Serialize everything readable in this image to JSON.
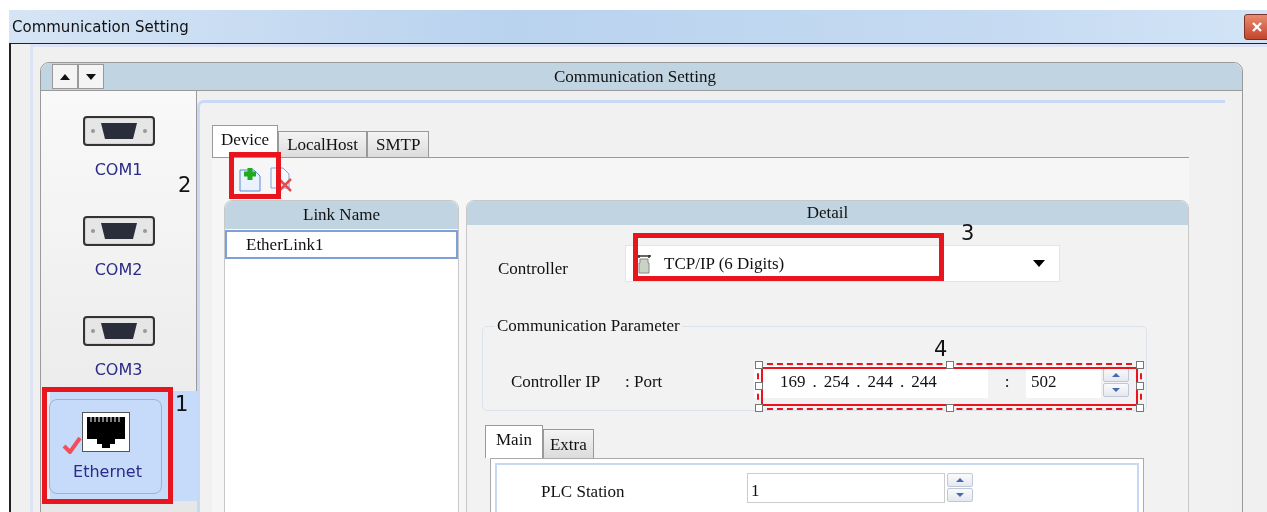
{
  "window": {
    "title": "Communication Setting"
  },
  "panel": {
    "title": "Communication Setting"
  },
  "sidebar": {
    "items": [
      {
        "label": "COM1",
        "kind": "serial",
        "selected": false
      },
      {
        "label": "COM2",
        "kind": "serial",
        "selected": false
      },
      {
        "label": "COM3",
        "kind": "serial",
        "selected": false
      },
      {
        "label": "Ethernet",
        "kind": "ethernet",
        "selected": true
      }
    ]
  },
  "tabs": [
    {
      "label": "Device",
      "selected": true
    },
    {
      "label": "LocalHost",
      "selected": false
    },
    {
      "label": "SMTP",
      "selected": false
    }
  ],
  "link_list": {
    "header": "Link Name",
    "rows": [
      {
        "name": "EtherLink1",
        "selected": true
      }
    ]
  },
  "detail": {
    "header": "Detail",
    "controller": {
      "label": "Controller",
      "value": "TCP/IP (6 Digits)"
    },
    "group": {
      "title": "Communication Parameter",
      "ip_label": "Controller IP",
      "port_label": ": Port",
      "ip": [
        "169",
        "254",
        "244",
        "244"
      ],
      "ip_separator": ".",
      "port_separator": ":",
      "port": "502"
    },
    "subtabs": [
      {
        "label": "Main",
        "selected": true
      },
      {
        "label": "Extra",
        "selected": false
      }
    ],
    "fields": [
      {
        "label": "PLC Station",
        "value": "1"
      }
    ]
  },
  "annotations": [
    {
      "label": "1",
      "kind": "frame"
    },
    {
      "label": "2",
      "kind": "frame"
    },
    {
      "label": "3",
      "kind": "frame"
    },
    {
      "label": "4",
      "kind": "dashed-frame"
    }
  ]
}
